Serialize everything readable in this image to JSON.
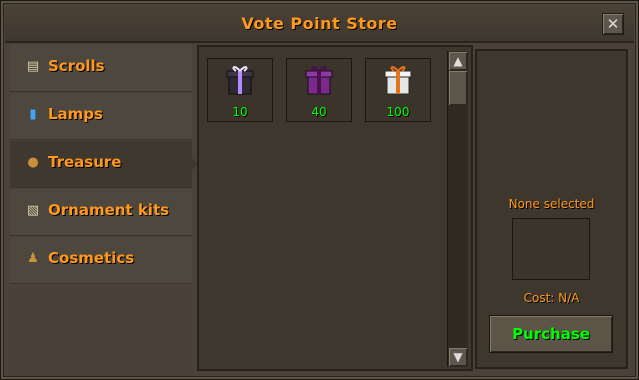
{
  "window": {
    "title": "Vote Point Store",
    "close_glyph": "✕"
  },
  "sidebar": {
    "items": [
      {
        "label": "Scrolls",
        "icon": "scroll-icon",
        "glyph": "▤",
        "active": false
      },
      {
        "label": "Lamps",
        "icon": "bar-chart-icon",
        "glyph": "▮",
        "active": false
      },
      {
        "label": "Treasure",
        "icon": "coin-pouch-icon",
        "glyph": "●",
        "active": true
      },
      {
        "label": "Ornament kits",
        "icon": "parchment-icon",
        "glyph": "▧",
        "active": false
      },
      {
        "label": "Cosmetics",
        "icon": "figure-icon",
        "glyph": "♟",
        "active": false
      }
    ]
  },
  "store": {
    "items": [
      {
        "price": "10",
        "icon": "purple-white-gift-icon",
        "box": "#2d2a33",
        "ribbon": "#b58cff"
      },
      {
        "price": "40",
        "icon": "purple-gift-icon",
        "box": "#7a2a8a",
        "ribbon": "#4a104f"
      },
      {
        "price": "100",
        "icon": "white-orange-gift-icon",
        "box": "#e6e6e6",
        "ribbon": "#e2731f"
      }
    ]
  },
  "details": {
    "selection": "None selected",
    "cost": "Cost: N/A",
    "purchase_label": "Purchase"
  },
  "colors": {
    "accent": "#ff981f",
    "price": "#00ff00"
  }
}
